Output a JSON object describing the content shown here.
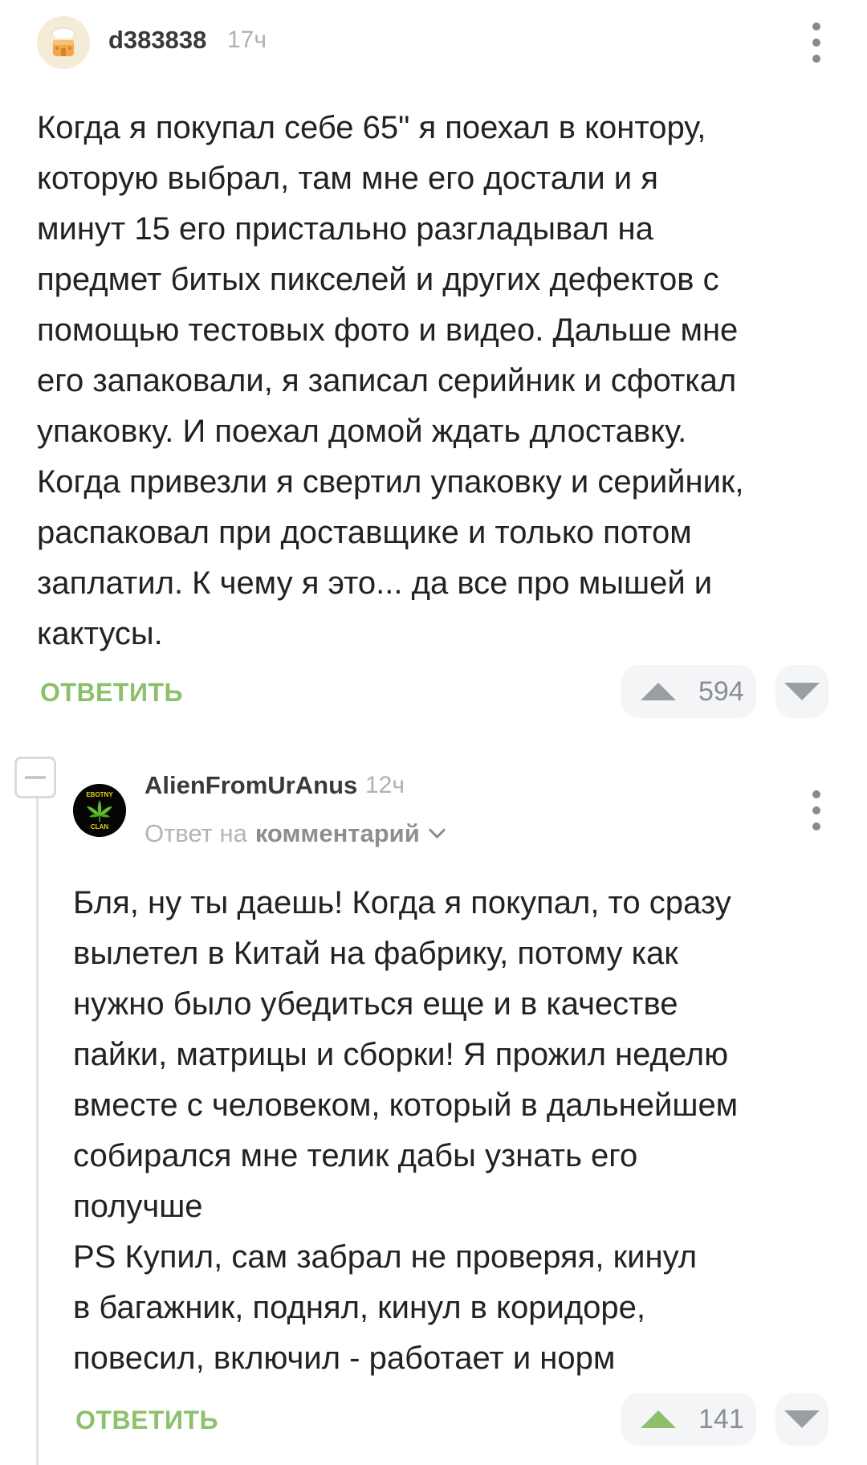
{
  "comments": [
    {
      "author": "d383838",
      "time": "17ч",
      "text": "Когда я покупал себе 65\" я поехал в контору,\nкоторую выбрал, там мне его достали и я\nминут 15 его пристально разгладывал на\nпредмет битых пикселей и других дефектов с\nпомощью тестовых фото и видео. Дальше мне\nего запаковали, я записал серийник и сфоткал\nупаковку. И поехал домой ждать длоставку.\nКогда привезли я свертил упаковку и серийник,\nраспаковал при  доставщике и только потом\nзаплатил. К чему я это... да все про мышей и\nкактусы.",
      "reply_label": "ОТВЕТИТЬ",
      "votes": "594",
      "upvoted": false
    },
    {
      "author": "AlienFromUrAnus",
      "time": "12ч",
      "reply_to_prefix": "Ответ на",
      "reply_to_link": "комментарий",
      "avatar_text_top": "EBOTNY",
      "avatar_text_bottom": "CLAN",
      "text": "Бля, ну ты даешь! Когда я покупал, то сразу\nвылетел в Китай на фабрику, потому как\nнужно было убедиться еще и в качестве\nпайки, матрицы и сборки! Я прожил неделю\nвместе с человеком, который в дальнейшем\nсобирался мне телик дабы узнать его\nполучше\nPS Купил, сам забрал не проверяя, кинул\nв багажник, поднял, кинул в коридоре,\nповесил, включил - работает и норм",
      "reply_label": "ОТВЕТИТЬ",
      "votes": "141",
      "upvoted": true
    }
  ],
  "colors": {
    "accent_green": "#8cc06b",
    "vote_bg": "#f4f5f6",
    "muted": "#b0b0b0"
  },
  "icons": [
    "avatar-cake-icon",
    "avatar-leaf-icon",
    "more-vert-icon",
    "upvote-icon",
    "downvote-icon",
    "collapse-icon",
    "chevron-down-icon"
  ]
}
